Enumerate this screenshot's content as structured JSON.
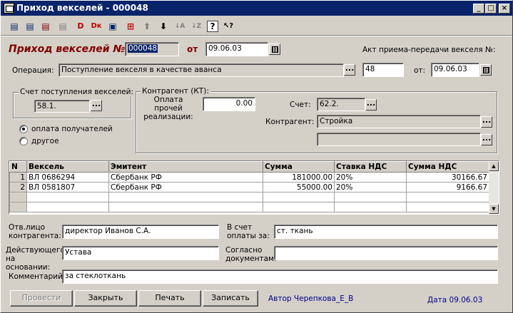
{
  "window": {
    "title": "Приход векселей - 000048",
    "min": "_",
    "max": "□",
    "close": "×"
  },
  "toolbar": [
    {
      "name": "toolbar-new-icon",
      "glyph": "▤"
    },
    {
      "name": "toolbar-add-row-icon",
      "glyph": "▤"
    },
    {
      "name": "toolbar-delete-row-icon",
      "glyph": "▤"
    },
    {
      "name": "toolbar-copy-icon",
      "glyph": "▤"
    },
    {
      "name": "toolbar-d-icon",
      "glyph": "D"
    },
    {
      "name": "toolbar-dk-icon",
      "glyph": "Dк"
    },
    {
      "name": "toolbar-edit-icon",
      "glyph": "▣"
    },
    {
      "name": "toolbar-insert-icon",
      "glyph": "⊞"
    },
    {
      "name": "toolbar-up-arrow-icon",
      "glyph": "⬆"
    },
    {
      "name": "toolbar-down-arrow-icon",
      "glyph": "⬇"
    },
    {
      "name": "toolbar-sort-asc-icon",
      "glyph": "↓A"
    },
    {
      "name": "toolbar-sort-desc-icon",
      "glyph": "↓Z"
    },
    {
      "name": "toolbar-help-icon",
      "glyph": "?"
    },
    {
      "name": "toolbar-whats-this-icon",
      "glyph": "↖?"
    }
  ],
  "header": {
    "doc_title": "Приход векселей №:",
    "doc_number": "000048",
    "from_label": "от",
    "doc_date": "09.06.03",
    "act_label": "Акт приема-передачи векселя №:"
  },
  "operation": {
    "label": "Операция:",
    "value": "Поступление векселя в качестве аванса",
    "act_number": "48",
    "act_from_label": "от:",
    "act_date": "09.06.03"
  },
  "account_group": {
    "title": "Счет поступления векселей:",
    "value": "58.1.",
    "radio_payers": "оплата получателей",
    "radio_other": "другое"
  },
  "counterparty_group": {
    "title": "Контрагент (КТ):",
    "other_payment_label": "Оплата прочей реализации:",
    "other_payment_value": "0.00",
    "account_label": "Счет:",
    "account_value": "62.2.",
    "counterparty_label": "Контрагент:",
    "counterparty_value": "Стройка",
    "extra_value": ""
  },
  "table": {
    "columns": [
      "N",
      "Вексель",
      "Эмитент",
      "Сумма",
      "Ставка НДС",
      "Сумма НДС"
    ],
    "rows": [
      [
        "1",
        "ВЛ  0686294",
        "Сбербанк РФ",
        "181000.00",
        "20%",
        "30166.67"
      ],
      [
        "2",
        "ВЛ  0581807",
        "Сбербанк РФ",
        "55000.00",
        "20%",
        "9166.67"
      ]
    ]
  },
  "footer": {
    "responsible_label": "Отв.лицо контрагента:",
    "responsible_value": "директор Иванов С.А.",
    "payment_for_label": "В счет оплаты за:",
    "payment_for_value": "ст. ткань",
    "basis_label": "Действующего на основании:",
    "basis_value": "Устава",
    "documents_label": "Согласно документам:",
    "documents_value": "",
    "comment_label": "Комментарий:",
    "comment_value": "за стеклоткань"
  },
  "buttons": {
    "post": "Провести",
    "close": "Закрыть",
    "print": "Печать",
    "save": "Записать"
  },
  "status": {
    "author": "Автор Черепкова_Е_В",
    "date": "Дата 09.06.03"
  }
}
